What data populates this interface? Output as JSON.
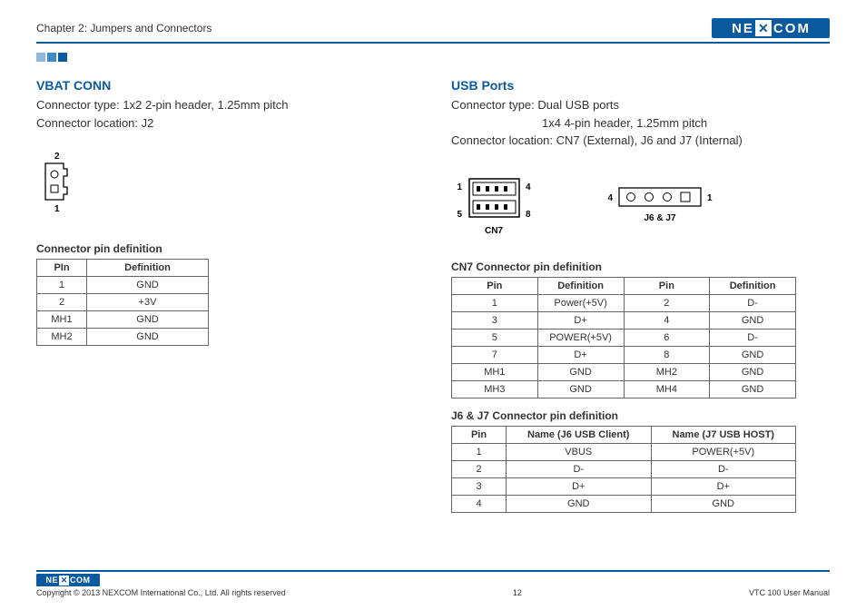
{
  "header": {
    "chapter": "Chapter 2: Jumpers and Connectors",
    "brand": "NEXCOM"
  },
  "left": {
    "title": "VBAT CONN",
    "conn_type": "Connector type: 1x2 2-pin header, 1.25mm pitch",
    "conn_loc": "Connector location: J2",
    "diag_label_top": "2",
    "diag_label_bottom": "1",
    "table_caption": "Connector pin definition",
    "table": {
      "headers": [
        "PIn",
        "Definition"
      ],
      "rows": [
        [
          "1",
          "GND"
        ],
        [
          "2",
          "+3V"
        ],
        [
          "MH1",
          "GND"
        ],
        [
          "MH2",
          "GND"
        ]
      ]
    }
  },
  "right": {
    "title": "USB Ports",
    "conn_type_line1": "Connector type:   Dual USB ports",
    "conn_type_line2": "1x4 4-pin header, 1.25mm pitch",
    "conn_loc": "Connector location: CN7 (External), J6 and J7 (Internal)",
    "cn7_labels": {
      "tl": "1",
      "tr": "4",
      "bl": "5",
      "br": "8",
      "name": "CN7"
    },
    "j6j7_labels": {
      "left": "4",
      "right": "1",
      "name": "J6 & J7"
    },
    "cn7_caption": "CN7 Connector pin definition",
    "cn7_table": {
      "headers": [
        "Pin",
        "Definition",
        "Pin",
        "Definition"
      ],
      "rows": [
        [
          "1",
          "Power(+5V)",
          "2",
          "D-"
        ],
        [
          "3",
          "D+",
          "4",
          "GND"
        ],
        [
          "5",
          "POWER(+5V)",
          "6",
          "D-"
        ],
        [
          "7",
          "D+",
          "8",
          "GND"
        ],
        [
          "MH1",
          "GND",
          "MH2",
          "GND"
        ],
        [
          "MH3",
          "GND",
          "MH4",
          "GND"
        ]
      ]
    },
    "j6j7_caption": "J6 & J7 Connector pin definition",
    "j6j7_table": {
      "headers": [
        "Pin",
        "Name (J6 USB Client)",
        "Name (J7 USB HOST)"
      ],
      "rows": [
        [
          "1",
          "VBUS",
          "POWER(+5V)"
        ],
        [
          "2",
          "D-",
          "D-"
        ],
        [
          "3",
          "D+",
          "D+"
        ],
        [
          "4",
          "GND",
          "GND"
        ]
      ]
    }
  },
  "footer": {
    "copyright": "Copyright © 2013 NEXCOM International Co., Ltd. All rights reserved",
    "page": "12",
    "doc": "VTC 100 User Manual"
  }
}
